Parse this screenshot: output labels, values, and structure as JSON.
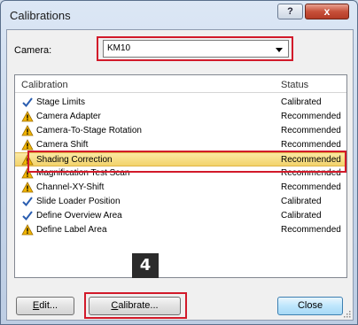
{
  "window": {
    "title": "Calibrations",
    "help_glyph": "?",
    "close_glyph": "x"
  },
  "camera": {
    "label": "Camera:",
    "value": "KM10"
  },
  "list": {
    "headers": {
      "name": "Calibration",
      "status": "Status"
    },
    "rows": [
      {
        "name": "Stage Limits",
        "status": "Calibrated",
        "icon": "check-icon"
      },
      {
        "name": "Camera Adapter",
        "status": "Recommended",
        "icon": "warning-icon"
      },
      {
        "name": "Camera-To-Stage Rotation",
        "status": "Recommended",
        "icon": "warning-icon"
      },
      {
        "name": "Camera Shift",
        "status": "Recommended",
        "icon": "warning-icon"
      },
      {
        "name": "Shading Correction",
        "status": "Recommended",
        "icon": "warning-icon",
        "selected": true
      },
      {
        "name": "Magnification Test Scan",
        "status": "Recommended",
        "icon": "warning-icon"
      },
      {
        "name": "Channel-XY-Shift",
        "status": "Recommended",
        "icon": "warning-icon"
      },
      {
        "name": "Slide Loader Position",
        "status": "Calibrated",
        "icon": "check-icon"
      },
      {
        "name": "Define Overview Area",
        "status": "Calibrated",
        "icon": "check-icon"
      },
      {
        "name": "Define Label Area",
        "status": "Recommended",
        "icon": "warning-icon"
      }
    ]
  },
  "step_badge": "4",
  "buttons": {
    "edit_key": "E",
    "edit_rest": "dit...",
    "calibrate_key": "C",
    "calibrate_rest": "alibrate...",
    "close": "Close"
  },
  "colors": {
    "highlight_frame": "#d21a2a",
    "selection": "#f2d36b",
    "check": "#2a5db0",
    "warning": "#f0b400"
  }
}
